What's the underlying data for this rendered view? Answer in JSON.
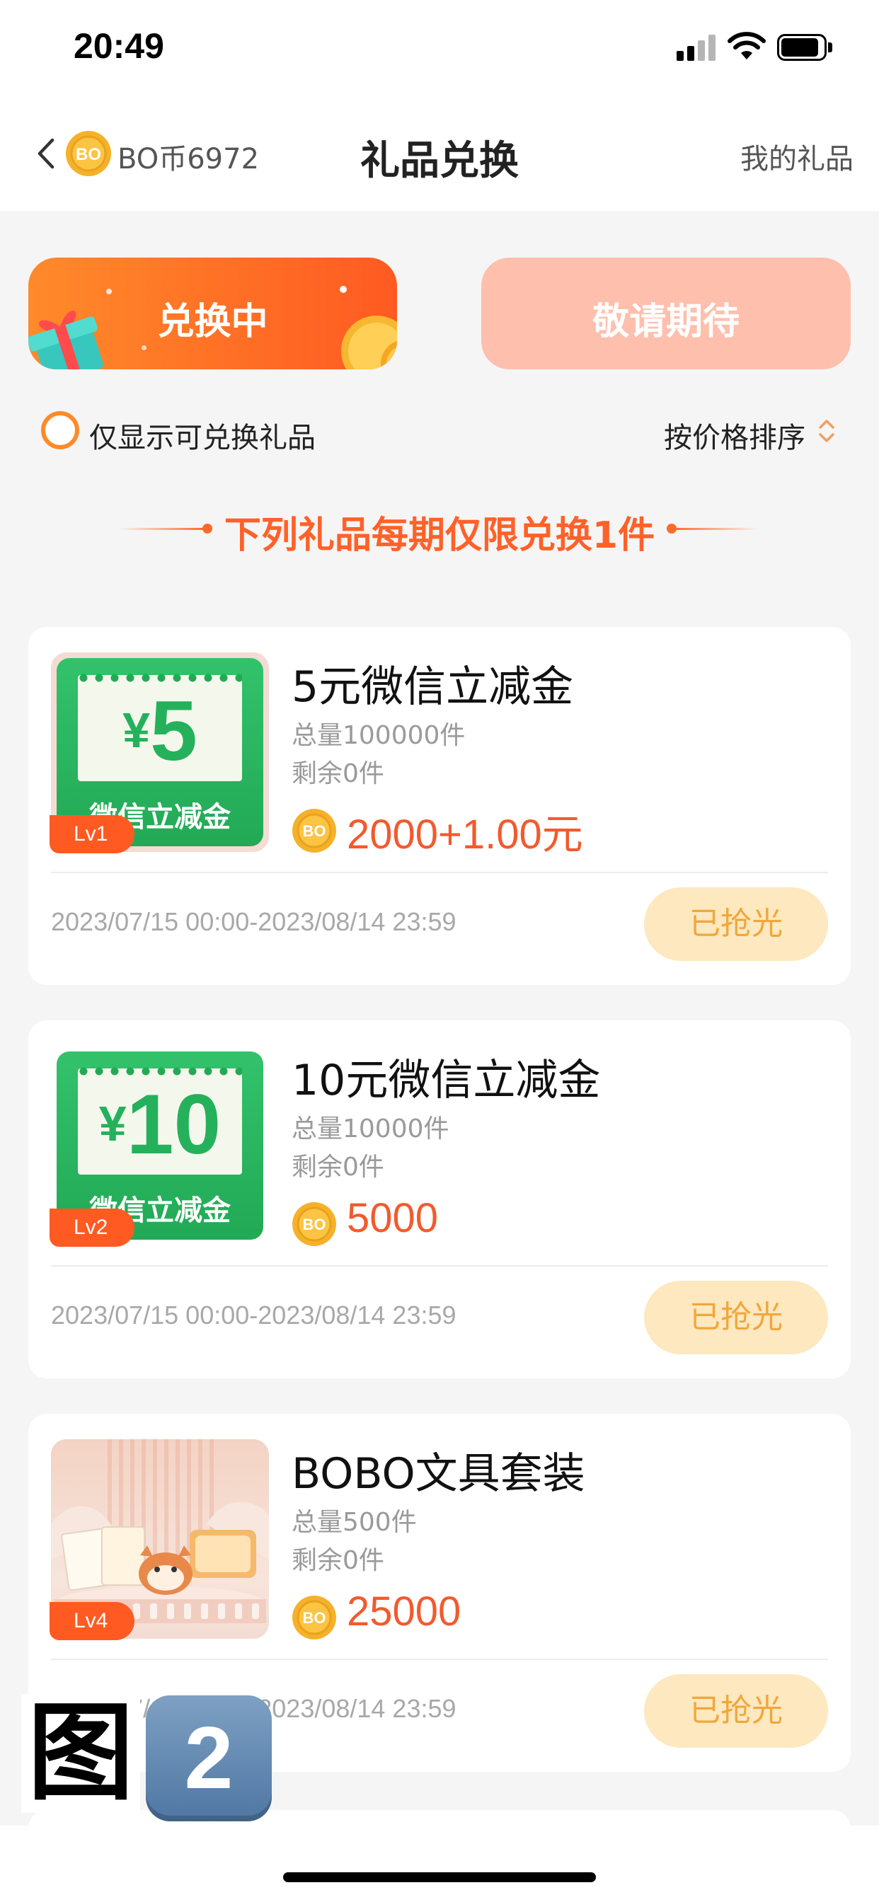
{
  "status_bar": {
    "time": "20:49",
    "icons": [
      "signal-icon",
      "wifi-icon",
      "battery-icon"
    ]
  },
  "nav": {
    "back_icon": "chevron-left-icon",
    "coin_icon": "bo-coin-icon",
    "coin_icon_text": "BO",
    "coin_balance": "BO币6972",
    "title": "礼品兑换",
    "my_gifts": "我的礼品"
  },
  "tabs": [
    {
      "label": "兑换中",
      "active": true
    },
    {
      "label": "敬请期待",
      "active": false
    }
  ],
  "filter": {
    "only_redeemable_label": "仅显示可兑换礼品",
    "sort_label": "按价格排序",
    "sort_icon": "sort-updown-icon"
  },
  "notice": "下列礼品每期仅限兑换1件",
  "gifts": [
    {
      "name": "5元微信立减金",
      "total": "总量100000件",
      "remaining": "剩余0件",
      "price": "2000+1.00元",
      "period": "2023/07/15 00:00-2023/08/14 23:59",
      "status": "已抢光",
      "level": "Lv1",
      "thumb": {
        "type": "wechat-voucher",
        "yen": "¥",
        "amount": "5",
        "caption": "微信立减金"
      }
    },
    {
      "name": "10元微信立减金",
      "total": "总量10000件",
      "remaining": "剩余0件",
      "price": "5000",
      "period": "2023/07/15 00:00-2023/08/14 23:59",
      "status": "已抢光",
      "level": "Lv2",
      "thumb": {
        "type": "wechat-voucher",
        "yen": "¥",
        "amount": "10",
        "caption": "微信立减金"
      }
    },
    {
      "name": "BOBO文具套装",
      "total": "总量500件",
      "remaining": "剩余0件",
      "price": "25000",
      "period": "2023/07/15 00:00-2023/08/14 23:59",
      "status": "已抢光",
      "level": "Lv4",
      "thumb": {
        "type": "stationery-photo"
      }
    }
  ],
  "overlay": {
    "label": "图",
    "number": "2"
  },
  "colors": {
    "accent": "#ff5a22",
    "price": "#f25a2e",
    "sold_out_bg": "#fde8bf",
    "sold_out_text": "#f0a73b",
    "voucher_green": "#25b15b"
  }
}
